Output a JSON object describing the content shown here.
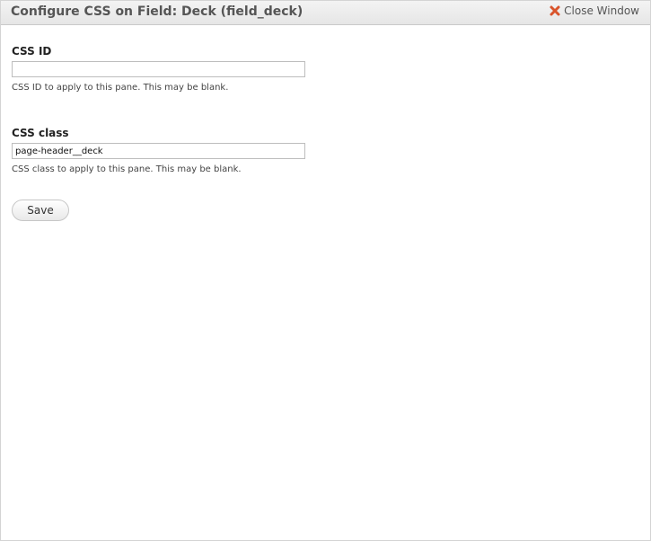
{
  "modal": {
    "title": "Configure CSS on Field: Deck (field_deck)",
    "close_label": "Close Window",
    "close_icon": "close-x-icon"
  },
  "form": {
    "css_id": {
      "label": "CSS ID",
      "value": "",
      "description": "CSS ID to apply to this pane. This may be blank."
    },
    "css_class": {
      "label": "CSS class",
      "value": "page-header__deck",
      "description": "CSS class to apply to this pane. This may be blank."
    },
    "save_label": "Save"
  },
  "colors": {
    "close_icon": "#d9542b",
    "title_text": "#555555"
  }
}
